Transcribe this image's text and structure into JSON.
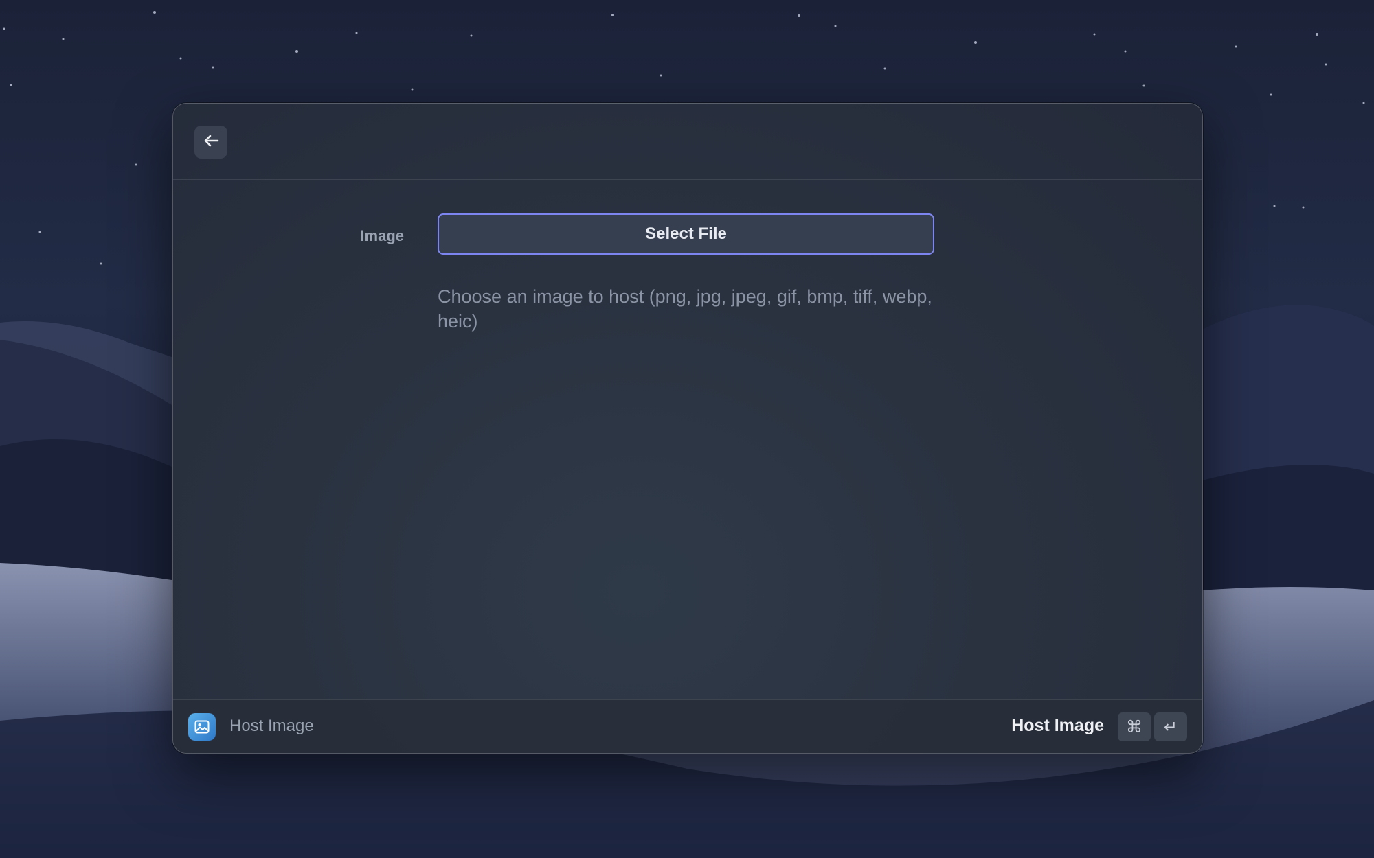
{
  "header": {
    "back_icon": "arrow-left-icon"
  },
  "form": {
    "field_label": "Image",
    "select_button_label": "Select File",
    "description": "Choose an image to host (png, jpg, jpeg, gif, bmp, tiff, webp, heic)"
  },
  "footer": {
    "app_icon": "image-icon",
    "command_title": "Host Image",
    "primary_action_label": "Host Image",
    "shortcut_keys": [
      "⌘",
      "↵"
    ]
  },
  "colors": {
    "accent_border": "#7d86f0",
    "app_icon_gradient": [
      "#5ab0ea",
      "#2e78c8"
    ]
  }
}
